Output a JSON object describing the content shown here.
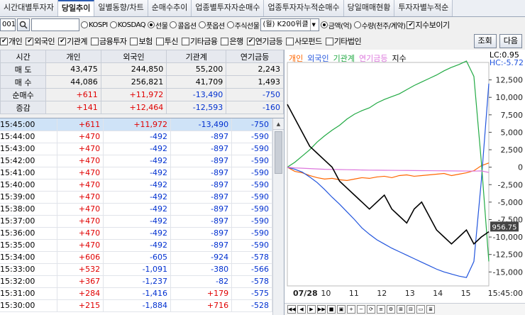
{
  "tabs": [
    "시간대별투자자",
    "당일추이",
    "일별동향/차트",
    "순매수추이",
    "업종별투자자순매수",
    "업종투자자누적순매수",
    "당일매매현황",
    "투자자별누적순"
  ],
  "active_tab": 1,
  "controls": {
    "code_value": "001",
    "radios_market": [
      {
        "label": "KOSPI",
        "on": false
      },
      {
        "label": "KOSDAQ",
        "on": false
      },
      {
        "label": "선물",
        "on": true
      },
      {
        "label": "콜옵션",
        "on": false
      },
      {
        "label": "풋옵션",
        "on": false
      },
      {
        "label": "주식선물",
        "on": false
      }
    ],
    "dropdown_value": "(월) K200위클",
    "radios_unit": [
      {
        "label": "금액(억)",
        "on": true
      },
      {
        "label": "수량(천주/계약)",
        "on": false
      }
    ],
    "show_index_label": "지수보이기"
  },
  "filters": [
    {
      "label": "개인",
      "on": true
    },
    {
      "label": "외국인",
      "on": true
    },
    {
      "label": "기관계",
      "on": true
    },
    {
      "label": "금융투자",
      "on": false
    },
    {
      "label": "보험",
      "on": false
    },
    {
      "label": "투신",
      "on": false
    },
    {
      "label": "기타금융",
      "on": false
    },
    {
      "label": "은행",
      "on": false
    },
    {
      "label": "연기금등",
      "on": true
    },
    {
      "label": "사모펀드",
      "on": false
    },
    {
      "label": "기타법인",
      "on": false
    }
  ],
  "buttons": {
    "query": "조회",
    "next": "다음"
  },
  "summary": {
    "headers": [
      "시간",
      "개인",
      "외국인",
      "기관계",
      "연기금등"
    ],
    "rows": [
      {
        "label": "매 도",
        "values": [
          "43,475",
          "244,850",
          "55,200",
          "2,243"
        ],
        "colors": [
          "",
          "",
          "",
          ""
        ]
      },
      {
        "label": "매 수",
        "values": [
          "44,086",
          "256,821",
          "41,709",
          "1,493"
        ],
        "colors": [
          "",
          "",
          "",
          ""
        ]
      },
      {
        "label": "순매수",
        "values": [
          "+611",
          "+11,972",
          "-13,490",
          "-750"
        ],
        "colors": [
          "red",
          "red",
          "blue",
          "blue"
        ]
      },
      {
        "label": "증감",
        "values": [
          "+141",
          "+12,464",
          "-12,593",
          "-160"
        ],
        "colors": [
          "red",
          "red",
          "blue",
          "blue"
        ]
      }
    ]
  },
  "grid_rows": [
    {
      "time": "15:45:00",
      "v": [
        "+611",
        "+11,972",
        "-13,490",
        "-750"
      ],
      "c": [
        "red",
        "red",
        "blue",
        "blue"
      ],
      "sel": true
    },
    {
      "time": "15:44:00",
      "v": [
        "+470",
        "-492",
        "-897",
        "-590"
      ],
      "c": [
        "red",
        "blue",
        "blue",
        "blue"
      ]
    },
    {
      "time": "15:43:00",
      "v": [
        "+470",
        "-492",
        "-897",
        "-590"
      ],
      "c": [
        "red",
        "blue",
        "blue",
        "blue"
      ]
    },
    {
      "time": "15:42:00",
      "v": [
        "+470",
        "-492",
        "-897",
        "-590"
      ],
      "c": [
        "red",
        "blue",
        "blue",
        "blue"
      ]
    },
    {
      "time": "15:41:00",
      "v": [
        "+470",
        "-492",
        "-897",
        "-590"
      ],
      "c": [
        "red",
        "blue",
        "blue",
        "blue"
      ]
    },
    {
      "time": "15:40:00",
      "v": [
        "+470",
        "-492",
        "-897",
        "-590"
      ],
      "c": [
        "red",
        "blue",
        "blue",
        "blue"
      ]
    },
    {
      "time": "15:39:00",
      "v": [
        "+470",
        "-492",
        "-897",
        "-590"
      ],
      "c": [
        "red",
        "blue",
        "blue",
        "blue"
      ]
    },
    {
      "time": "15:38:00",
      "v": [
        "+470",
        "-492",
        "-897",
        "-590"
      ],
      "c": [
        "red",
        "blue",
        "blue",
        "blue"
      ]
    },
    {
      "time": "15:37:00",
      "v": [
        "+470",
        "-492",
        "-897",
        "-590"
      ],
      "c": [
        "red",
        "blue",
        "blue",
        "blue"
      ]
    },
    {
      "time": "15:36:00",
      "v": [
        "+470",
        "-492",
        "-897",
        "-590"
      ],
      "c": [
        "red",
        "blue",
        "blue",
        "blue"
      ]
    },
    {
      "time": "15:35:00",
      "v": [
        "+470",
        "-492",
        "-897",
        "-590"
      ],
      "c": [
        "red",
        "blue",
        "blue",
        "blue"
      ]
    },
    {
      "time": "15:34:00",
      "v": [
        "+606",
        "-605",
        "-924",
        "-578"
      ],
      "c": [
        "red",
        "blue",
        "blue",
        "blue"
      ]
    },
    {
      "time": "15:33:00",
      "v": [
        "+532",
        "-1,091",
        "-380",
        "-566"
      ],
      "c": [
        "red",
        "blue",
        "blue",
        "blue"
      ]
    },
    {
      "time": "15:32:00",
      "v": [
        "+367",
        "-1,237",
        "-82",
        "-578"
      ],
      "c": [
        "red",
        "blue",
        "blue",
        "blue"
      ]
    },
    {
      "time": "15:31:00",
      "v": [
        "+284",
        "-1,416",
        "+179",
        "-575"
      ],
      "c": [
        "red",
        "blue",
        "red",
        "blue"
      ]
    },
    {
      "time": "15:30:00",
      "v": [
        "+215",
        "-1,884",
        "+716",
        "-528"
      ],
      "c": [
        "red",
        "blue",
        "red",
        "blue"
      ]
    }
  ],
  "chart": {
    "legend": [
      {
        "label": "개인",
        "color": "#ff6600"
      },
      {
        "label": "외국인",
        "color": "#2255dd"
      },
      {
        "label": "기관계",
        "color": "#22aa44"
      },
      {
        "label": "연기금등",
        "color": "#dd77dd"
      },
      {
        "label": "지수",
        "color": "#000000"
      }
    ],
    "lc": "LC:0.95",
    "hc": "HC:-5.72",
    "y_ticks": [
      "12,500",
      "10,000",
      "7,500",
      "5,000",
      "2,500",
      "0",
      "-2,500",
      "-5,000",
      "-7,500",
      "-10,000",
      "-12,500",
      "-15,000"
    ],
    "x_ticks": [
      "07/28",
      "10",
      "11",
      "12",
      "13",
      "14",
      "15"
    ],
    "x_end_label": "15:45:00",
    "index_badge": "956.75"
  },
  "chart_data": {
    "type": "line",
    "x": [
      "09:00",
      "09:15",
      "09:30",
      "09:45",
      "10:00",
      "10:15",
      "10:30",
      "10:45",
      "11:00",
      "11:15",
      "11:30",
      "11:45",
      "12:00",
      "12:15",
      "12:30",
      "12:45",
      "13:00",
      "13:15",
      "13:30",
      "13:45",
      "14:00",
      "14:15",
      "14:30",
      "14:45",
      "15:00",
      "15:15",
      "15:30",
      "15:45"
    ],
    "series": [
      {
        "name": "개인",
        "values": [
          0,
          -600,
          -800,
          -1200,
          -1500,
          -1700,
          -1600,
          -1800,
          -1900,
          -1700,
          -1500,
          -1600,
          -1400,
          -1300,
          -1500,
          -1200,
          -1100,
          -1300,
          -1200,
          -1100,
          -1000,
          -900,
          -1200,
          -1000,
          -800,
          -500,
          215,
          611
        ]
      },
      {
        "name": "외국인",
        "values": [
          0,
          -300,
          -700,
          -1400,
          -2200,
          -3200,
          -4300,
          -5300,
          -6400,
          -7500,
          -8700,
          -9600,
          -10400,
          -11000,
          -11600,
          -12100,
          -12600,
          -13100,
          -13600,
          -14100,
          -14600,
          -15000,
          -15300,
          -15600,
          -15800,
          -13500,
          -1884,
          11972
        ]
      },
      {
        "name": "기관계",
        "values": [
          0,
          700,
          1600,
          2500,
          3600,
          4500,
          5300,
          6000,
          6900,
          7600,
          8100,
          8500,
          9200,
          9700,
          10100,
          10500,
          11100,
          11700,
          12200,
          12700,
          13200,
          13800,
          14300,
          14700,
          15200,
          13000,
          716,
          -13490
        ]
      },
      {
        "name": "연기금등",
        "values": [
          0,
          -100,
          -150,
          -200,
          -250,
          -300,
          -320,
          -340,
          -360,
          -380,
          -400,
          -420,
          -430,
          -440,
          -450,
          -460,
          -470,
          -480,
          -490,
          -500,
          -510,
          -520,
          -530,
          -540,
          -550,
          -560,
          -528,
          -750
        ]
      },
      {
        "name": "지수",
        "values": [
          975,
          973,
          971,
          969,
          968,
          967,
          966,
          964,
          963,
          962,
          961,
          960,
          961,
          962,
          960,
          959,
          958,
          960,
          961,
          959,
          957,
          956,
          955,
          956,
          957,
          955,
          956,
          956.75
        ]
      }
    ],
    "ylim": [
      -17000,
      15000
    ],
    "grid": false,
    "legend_position": "top-left"
  },
  "bottom_controls": [
    "◀◀",
    "◀",
    "▶",
    "▶▶",
    "■",
    "▣",
    "+",
    "−",
    "⟳",
    "≡",
    "⚙",
    "⊞",
    "⊟",
    "▭",
    "≣"
  ]
}
